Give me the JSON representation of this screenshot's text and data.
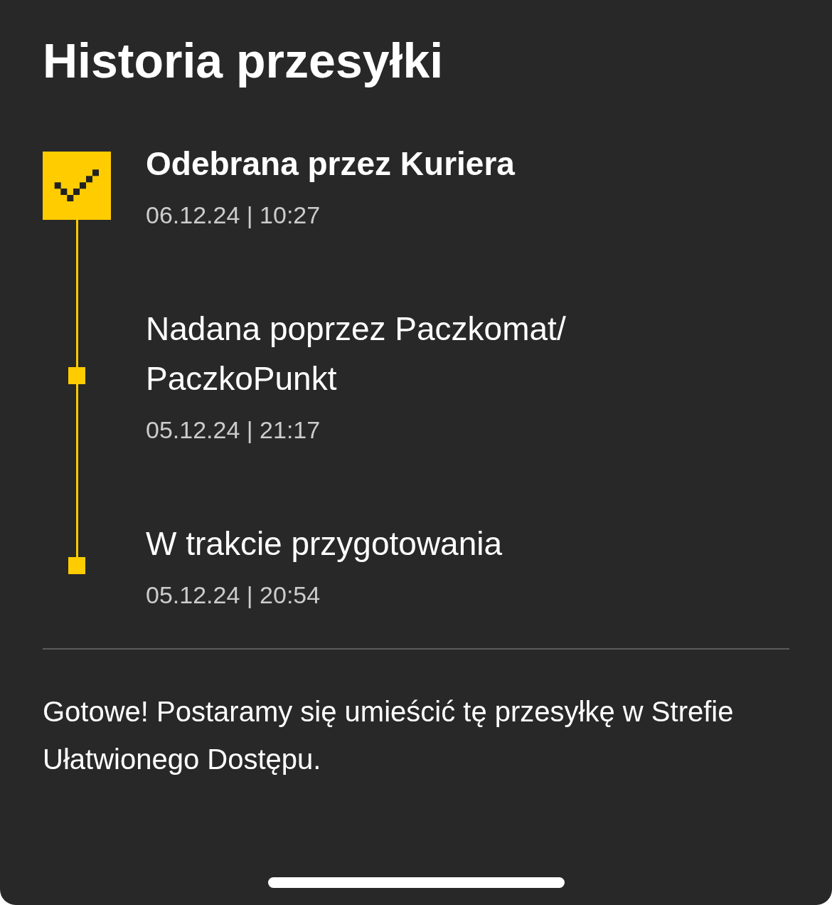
{
  "title": "Historia przesyłki",
  "events": [
    {
      "title": "Odebrana przez Kuriera",
      "date": "06.12.24 | 10:27",
      "current": true
    },
    {
      "title": "Nadana poprzez Paczkomat/PaczkoPunkt",
      "date": "05.12.24 | 21:17",
      "current": false
    },
    {
      "title": "W trakcie przygotowania",
      "date": "05.12.24 | 20:54",
      "current": false
    }
  ],
  "message": "Gotowe! Postaramy się umieścić tę przesyłkę w Strefie Ułatwionego Dostępu."
}
